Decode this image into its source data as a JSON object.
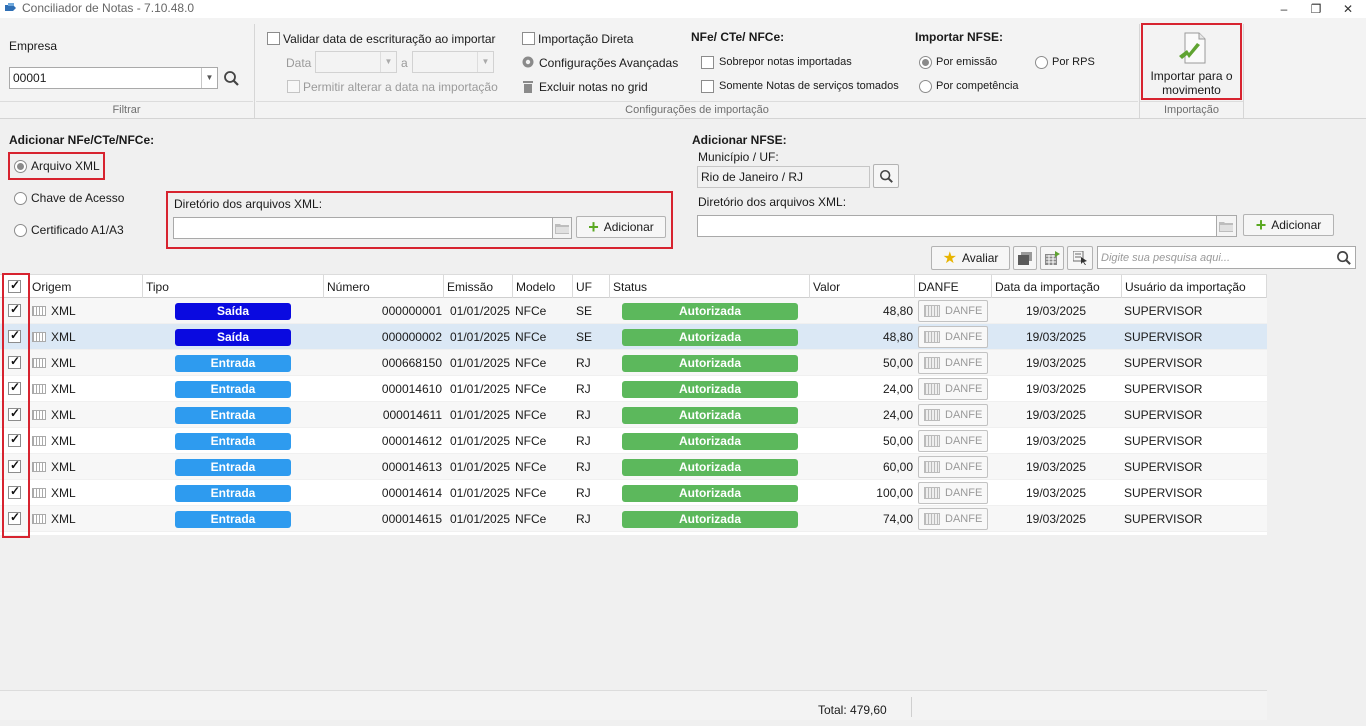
{
  "window": {
    "title": "Conciliador de Notas - 7.10.48.0"
  },
  "ribbon": {
    "filtrar": {
      "empresa_label": "Empresa",
      "empresa_value": "00001",
      "caption": "Filtrar"
    },
    "config": {
      "validar_data_label": "Validar data de escrituração ao importar",
      "data_label": "Data",
      "a_label": "a",
      "permitir_label": "Permitir alterar a data na importação",
      "importacao_direta_label": "Importação Direta",
      "config_avancadas_label": "Configurações Avançadas",
      "excluir_notas_label": "Excluir notas no grid",
      "nfe_title": "NFe/ CTe/ NFCe:",
      "sobrepor_label": "Sobrepor notas importadas",
      "somente_label": "Somente Notas de serviços tomados",
      "nfse_title": "Importar NFSE:",
      "por_emissao_label": "Por emissão",
      "por_rps_label": "Por RPS",
      "por_competencia_label": "Por competência",
      "caption": "Configurações de importação"
    },
    "importacao": {
      "button_label": "Importar para o movimento",
      "caption": "Importação"
    }
  },
  "add_nfe": {
    "title": "Adicionar NFe/CTe/NFCe:",
    "options": [
      "Arquivo XML",
      "Chave de Acesso",
      "Certificado A1/A3"
    ],
    "selected": "Arquivo XML",
    "dir_label": "Diretório dos arquivos XML:",
    "dir_value": "",
    "add_button": "Adicionar"
  },
  "add_nfse": {
    "title": "Adicionar NFSE:",
    "municipio_label": "Município / UF:",
    "municipio_value": "Rio de Janeiro / RJ",
    "dir_label": "Diretório dos arquivos XML:",
    "dir_value": "",
    "add_button": "Adicionar"
  },
  "toolbar": {
    "avaliar_label": "Avaliar",
    "search_placeholder": "Digite sua pesquisa aqui..."
  },
  "colors": {
    "saida": "#0a0ae0",
    "entrada": "#2e9bef",
    "autorizada": "#5cb85c",
    "red_highlight": "#d7232f"
  },
  "grid": {
    "columns": [
      "Origem",
      "Tipo",
      "Número",
      "Emissão",
      "Modelo",
      "UF",
      "Status",
      "Valor",
      "DANFE",
      "Data da importação",
      "Usuário da importação"
    ],
    "danfe_label": "DANFE",
    "rows": [
      {
        "checked": true,
        "origem": "XML",
        "tipo": "Saída",
        "numero": "000000001",
        "emissao": "01/01/2025",
        "modelo": "NFCe",
        "uf": "SE",
        "status": "Autorizada",
        "valor": "48,80",
        "data_importacao": "19/03/2025",
        "usuario": "SUPERVISOR"
      },
      {
        "checked": true,
        "origem": "XML",
        "tipo": "Saída",
        "numero": "000000002",
        "emissao": "01/01/2025",
        "modelo": "NFCe",
        "uf": "SE",
        "status": "Autorizada",
        "valor": "48,80",
        "data_importacao": "19/03/2025",
        "usuario": "SUPERVISOR"
      },
      {
        "checked": true,
        "origem": "XML",
        "tipo": "Entrada",
        "numero": "000668150",
        "emissao": "01/01/2025",
        "modelo": "NFCe",
        "uf": "RJ",
        "status": "Autorizada",
        "valor": "50,00",
        "data_importacao": "19/03/2025",
        "usuario": "SUPERVISOR"
      },
      {
        "checked": true,
        "origem": "XML",
        "tipo": "Entrada",
        "numero": "000014610",
        "emissao": "01/01/2025",
        "modelo": "NFCe",
        "uf": "RJ",
        "status": "Autorizada",
        "valor": "24,00",
        "data_importacao": "19/03/2025",
        "usuario": "SUPERVISOR"
      },
      {
        "checked": true,
        "origem": "XML",
        "tipo": "Entrada",
        "numero": "000014611",
        "emissao": "01/01/2025",
        "modelo": "NFCe",
        "uf": "RJ",
        "status": "Autorizada",
        "valor": "24,00",
        "data_importacao": "19/03/2025",
        "usuario": "SUPERVISOR"
      },
      {
        "checked": true,
        "origem": "XML",
        "tipo": "Entrada",
        "numero": "000014612",
        "emissao": "01/01/2025",
        "modelo": "NFCe",
        "uf": "RJ",
        "status": "Autorizada",
        "valor": "50,00",
        "data_importacao": "19/03/2025",
        "usuario": "SUPERVISOR"
      },
      {
        "checked": true,
        "origem": "XML",
        "tipo": "Entrada",
        "numero": "000014613",
        "emissao": "01/01/2025",
        "modelo": "NFCe",
        "uf": "RJ",
        "status": "Autorizada",
        "valor": "60,00",
        "data_importacao": "19/03/2025",
        "usuario": "SUPERVISOR"
      },
      {
        "checked": true,
        "origem": "XML",
        "tipo": "Entrada",
        "numero": "000014614",
        "emissao": "01/01/2025",
        "modelo": "NFCe",
        "uf": "RJ",
        "status": "Autorizada",
        "valor": "100,00",
        "data_importacao": "19/03/2025",
        "usuario": "SUPERVISOR"
      },
      {
        "checked": true,
        "origem": "XML",
        "tipo": "Entrada",
        "numero": "000014615",
        "emissao": "01/01/2025",
        "modelo": "NFCe",
        "uf": "RJ",
        "status": "Autorizada",
        "valor": "74,00",
        "data_importacao": "19/03/2025",
        "usuario": "SUPERVISOR"
      }
    ]
  },
  "footer": {
    "total": "Total: 479,60"
  }
}
